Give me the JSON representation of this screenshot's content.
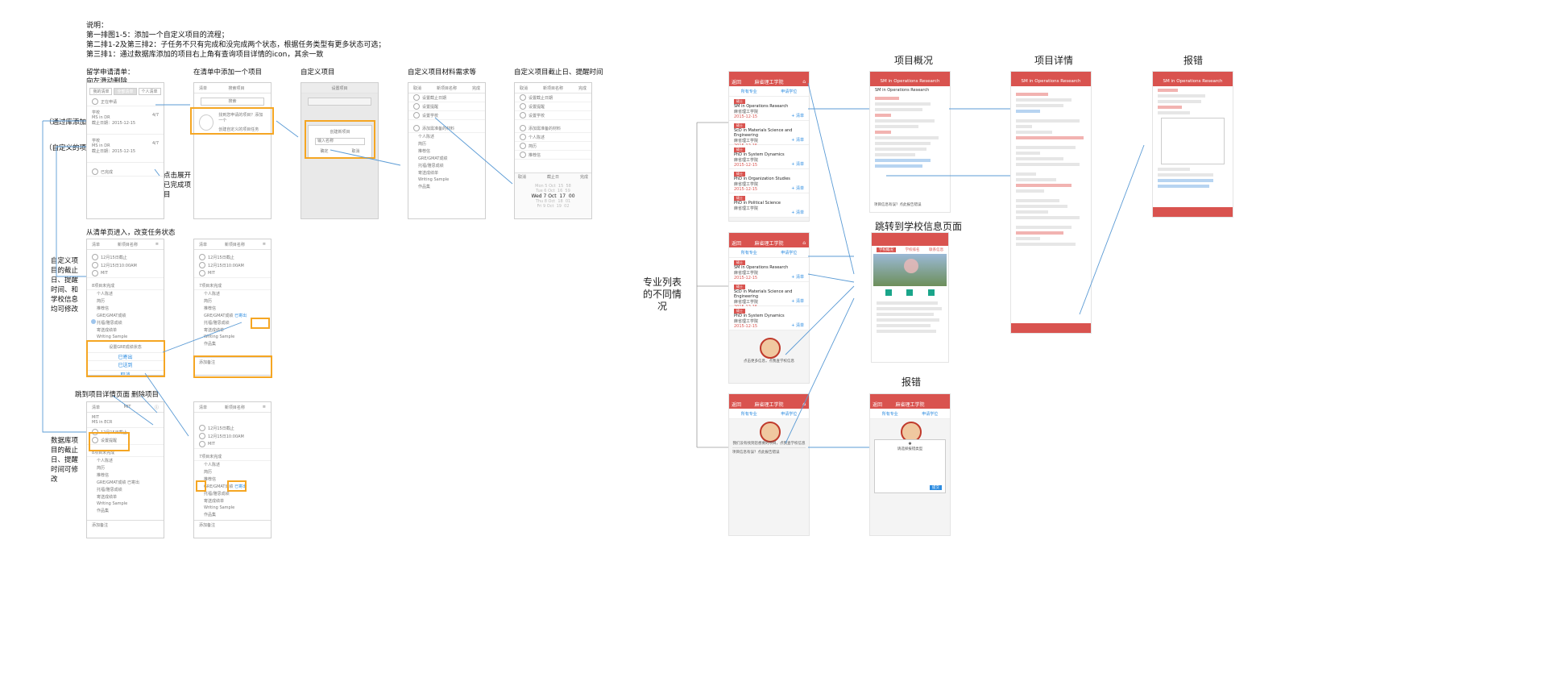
{
  "notes": {
    "title": "说明：",
    "line1": "第一排图1-5：添加一个自定义项目的流程；",
    "line2": "第二排1-2及第三排2：子任务不只有完成和没完成两个状态，根据任务类型有更多状态可选；",
    "line3": "第三排1：通过数据库添加的项目右上角有查询项目详情的icon，其余一致"
  },
  "captions": {
    "c1a": "留学申请清单：",
    "c1b": "向左滑动删除",
    "c2": "在清单中添加一个项目",
    "c3": "自定义项目",
    "c4": "自定义项目材料需求等",
    "c5": "自定义项目截止日、提醒时间",
    "row2": "从清单页进入，改变任务状态",
    "row3a": "跳到项目详情页面",
    "row3b": "删除项目"
  },
  "left_annotations": {
    "db_added": "（通过库添加的项目）",
    "custom": "（自定义的项目）",
    "expand": "点击展开已完成项目",
    "custom_edit": "自定义项目的截止日、提醒时间、和学校信息均可修改",
    "db_edit": "数据库项目的截止日、提醒时间可修改"
  },
  "wireframes": {
    "w1": {
      "tabs": [
        "我的清单",
        "全部清单",
        "个人清单"
      ],
      "add": "正在申请",
      "items": [
        {
          "school": "学校",
          "prog": "MS in DR",
          "date": "截止日期：2015-12-15",
          "count": "4/7"
        },
        {
          "school": "学校",
          "prog": "MS in DR",
          "date": "截止日期：2015-12-15",
          "count": "4/7"
        }
      ],
      "done": "已完成"
    },
    "w2": {
      "title": "清单",
      "sub": "搜索项目",
      "btn": "搜索",
      "hint1": "找到您申请的项目？添加一个",
      "hint2": "创建自定义的项目任务"
    },
    "w3": {
      "title": "创建新项目",
      "input": "输入名称",
      "ok": "确定",
      "cancel": "取消"
    },
    "w4": {
      "head": "新项目名称",
      "rows": [
        "设置截止日期",
        "设置提醒",
        "设置学校"
      ],
      "section": "添加需准备的材料",
      "materials": [
        "个人陈述",
        "简历",
        "推荐信",
        "GRE/GMAT成绩",
        "托福/雅思成绩",
        "寄送成绩单",
        "Writing Sample",
        "作品集"
      ]
    },
    "w5": {
      "date": "Wed 7 Oct",
      "h": "17",
      "m": "00",
      "picker": "截止日",
      "done": "完成"
    },
    "w6": {
      "rows": [
        "12月15日截止",
        "12月15日10:00AM",
        "MIT"
      ],
      "section": "8项目未完成",
      "materials": [
        "个人陈述",
        "简历",
        "推荐信",
        "GRE/GMAT成绩",
        "托福/雅思成绩",
        "寄送成绩单",
        "Writing Sample",
        "作品集"
      ],
      "sheet_title": "设置GRE成绩状态",
      "opt1": "已寄出",
      "opt2": "已送到",
      "cancel": "取消"
    },
    "w7": {
      "status": "已寄出",
      "note": "添加备注"
    },
    "w8": {
      "title": "MIT",
      "sub": "MS in ECR",
      "rows": [
        "12月15日截止",
        "设置提醒"
      ],
      "note": "添加备注"
    },
    "w9": {
      "status": "已寄出",
      "note": "添加备注"
    }
  },
  "right": {
    "left_label": "专业列表的不同情况",
    "titles": {
      "overview": "项目概况",
      "detail": "项目详情",
      "error": "报错",
      "school": "跳转到学校信息页面",
      "error2": "报错"
    },
    "nav_title": "麻省理工学院",
    "back": "返回",
    "tabs": [
      "所有专业",
      "申请学位"
    ],
    "programs": [
      {
        "name": "SM in Operations Research",
        "school": "麻省理工学院",
        "date": "2015-12-15"
      },
      {
        "name": "ScD in Materials Science and Engineering",
        "school": "麻省理工学院",
        "date": "2015-12-15"
      },
      {
        "name": "PhD in System Dynamics",
        "school": "麻省理工学院",
        "date": "2015-12-15"
      },
      {
        "name": "PhD in Organization Studies",
        "school": "麻省理工学院",
        "date": "2015-12-15"
      },
      {
        "name": "PhD in Political Science",
        "school": "麻省理工学院",
        "date": ""
      }
    ],
    "more_hint": "点击更多信息，点我查学校信息",
    "empty_hint": "我们没有找到您想要的项目，点我查学校信息",
    "report": "项目信息有误？点此报告错误",
    "overview_head": "SM in Operations Research",
    "school_tabs": [
      "学校概况",
      "学校排名",
      "联系信息"
    ],
    "dialog_title": "请选择报错类型",
    "submit": "提交"
  }
}
